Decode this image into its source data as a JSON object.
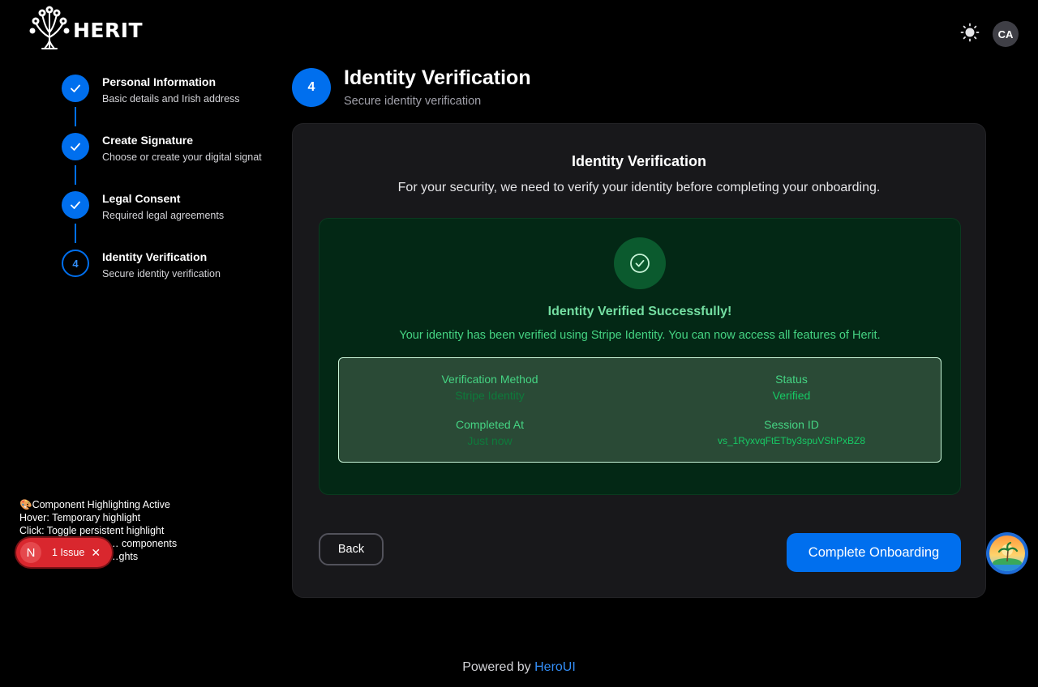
{
  "header": {
    "logo_text": "HERIT",
    "theme_icon": "sun-icon",
    "avatar_initials": "CA"
  },
  "stepper": {
    "steps": [
      {
        "title": "Personal Information",
        "subtitle": "Basic details and Irish address",
        "state": "done"
      },
      {
        "title": "Create Signature",
        "subtitle": "Choose or create your digital signat",
        "state": "done"
      },
      {
        "title": "Legal Consent",
        "subtitle": "Required legal agreements",
        "state": "done"
      },
      {
        "title": "Identity Verification",
        "subtitle": "Secure identity verification",
        "state": "current",
        "number": "4"
      }
    ]
  },
  "page": {
    "step_number": "4",
    "title": "Identity Verification",
    "subtitle": "Secure identity verification"
  },
  "card": {
    "title": "Identity Verification",
    "description": "For your security, we need to verify your identity before completing your onboarding.",
    "success": {
      "icon": "check-circle-icon",
      "title": "Identity Verified Successfully!",
      "description": "Your identity has been verified using Stripe Identity. You can now access all features of Herit."
    },
    "details": {
      "method_label": "Verification Method",
      "method_value": "Stripe Identity",
      "status_label": "Status",
      "status_value": "Verified",
      "completed_label": "Completed At",
      "completed_value": "Just now",
      "session_label": "Session ID",
      "session_value": "vs_1RyxvqFtETby3spuVShPxBZ8"
    },
    "back_label": "Back",
    "complete_label": "Complete Onboarding"
  },
  "dev_panel": {
    "line1": "🎨Component Highlighting Active",
    "line2": "Hover: Temporary highlight",
    "line3": "Click: Toggle persistent highlight",
    "line4": "… components",
    "line5": "…ghts"
  },
  "issues": {
    "badge": "N",
    "label": "1 Issue",
    "close": "✕"
  },
  "footer": {
    "prefix": "Powered by ",
    "link": "HeroUI"
  },
  "colors": {
    "accent": "#006fee",
    "success": "#17c964",
    "success_bg": "#032815",
    "error": "#d9272e"
  }
}
